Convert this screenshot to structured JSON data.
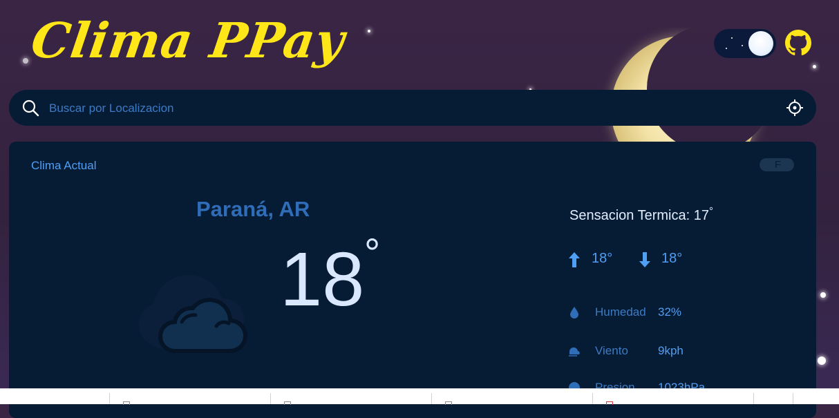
{
  "header": {
    "app_title": "Clima PPay",
    "theme_toggle_state": "dark",
    "github_icon": "github-icon"
  },
  "search": {
    "placeholder": "Buscar por Localizacion",
    "value": "",
    "search_icon": "search-icon",
    "location_icon": "crosshair-icon"
  },
  "current": {
    "label": "Clima Actual",
    "unit_toggle": "F",
    "city": "Paraná, AR",
    "temperature": "18",
    "degree_symbol": "°",
    "condition_icon": "cloudy-icon",
    "feels_like_label": "Sensacion Termica: 17",
    "feels_like_degree": "°",
    "max_temp": "18°",
    "min_temp": "18°",
    "details": [
      {
        "icon": "droplet-icon",
        "label": "Humedad",
        "value": "32%"
      },
      {
        "icon": "wind-icon",
        "label": "Viento",
        "value": "9kph"
      },
      {
        "icon": "gauge-icon",
        "label": "Presion",
        "value": "1023hPa"
      }
    ]
  },
  "colors": {
    "background": "#3a2545",
    "panel": "#061b34",
    "title_yellow": "#ffe619",
    "accent_blue": "#4f9ff5",
    "city_blue": "#2f6db8"
  }
}
